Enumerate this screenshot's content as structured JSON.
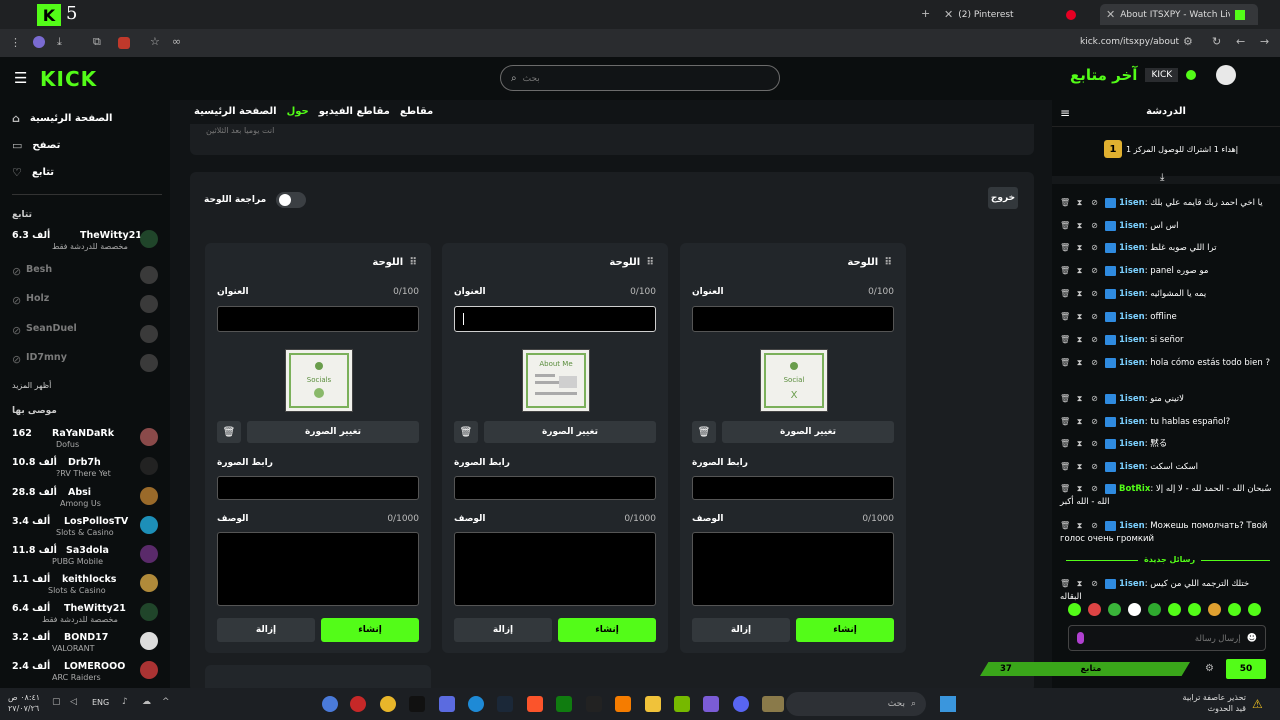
{
  "browser": {
    "tabs": [
      {
        "label": "(2) Pinterest"
      },
      {
        "label": "About ITSXPY - Watch Live on"
      }
    ],
    "url": "kick.com/itsxpy/about"
  },
  "header": {
    "logo": "KICK",
    "search_placeholder": "بحث",
    "overlay_text": "آخر متابع",
    "overlay_badge": "KICK"
  },
  "sidebar": {
    "nav": [
      {
        "label": "الصفحة الرئيسية"
      },
      {
        "label": "تصفح"
      },
      {
        "label": "تتابع"
      }
    ],
    "following_title": "تتابع",
    "following": [
      {
        "viewers": "6.3 ألف",
        "name": "TheWitty21",
        "sub": "مخصصة للدردشة فقط"
      }
    ],
    "offline": [
      "Besh",
      "Holz",
      "SeanDuel",
      "ID7mny"
    ],
    "show_more": "أظهر المزيد",
    "recommended_title": "موصى بها",
    "recommended": [
      {
        "viewers": "162",
        "name": "RaYaNDaRk",
        "sub": "Dofus"
      },
      {
        "viewers": "10.8 ألف",
        "name": "Drb7h",
        "sub": "?RV There Yet"
      },
      {
        "viewers": "28.8 ألف",
        "name": "Absi",
        "sub": "Among Us"
      },
      {
        "viewers": "3.4 ألف",
        "name": "LosPollosTV",
        "sub": "Slots & Casino"
      },
      {
        "viewers": "11.8 ألف",
        "name": "Sa3dola",
        "sub": "PUBG Mobile"
      },
      {
        "viewers": "1.1 ألف",
        "name": "keithlocks",
        "sub": "Slots & Casino"
      },
      {
        "viewers": "6.4 ألف",
        "name": "TheWitty21",
        "sub": "مخصصة للدردشة فقط"
      },
      {
        "viewers": "3.2 ألف",
        "name": "BOND17",
        "sub": "VALORANT"
      },
      {
        "viewers": "2.4 ألف",
        "name": "LOMEROOO",
        "sub": "ARC Raiders"
      }
    ]
  },
  "channel_tabs": [
    "مقاطع",
    "مقاطع الفيديو",
    "حول",
    "الصفحة الرئيسية"
  ],
  "topcard_text": "انت يوميا بعد الثلاثين",
  "editor": {
    "exit": "خروج",
    "review_label": "مراجعة اللوحة",
    "panels": [
      {
        "title": "اللوحة",
        "title_label": "العنوان",
        "title_count": "0/100",
        "change_image": "تغيير الصورة",
        "link_label": "رابط الصورة",
        "desc_label": "الوصف",
        "desc_count": "0/1000",
        "remove": "إزالة",
        "create": "إنشاء",
        "thumb_text": "Socials"
      },
      {
        "title": "اللوحة",
        "title_label": "العنوان",
        "title_count": "0/100",
        "change_image": "تغيير الصورة",
        "link_label": "رابط الصورة",
        "desc_label": "الوصف",
        "desc_count": "0/1000",
        "remove": "إزالة",
        "create": "إنشاء",
        "thumb_text": "About Me"
      },
      {
        "title": "اللوحة",
        "title_label": "العنوان",
        "title_count": "0/100",
        "change_image": "تغيير الصورة",
        "link_label": "رابط الصورة",
        "desc_label": "الوصف",
        "desc_count": "0/1000",
        "remove": "إزالة",
        "create": "إنشاء",
        "thumb_text": "Social"
      }
    ]
  },
  "chat": {
    "title": "الدردشة",
    "gift_text": "إهداء 1 اشتراك للوصول المركز 1",
    "gift_rank": "1",
    "messages": [
      {
        "user": "1isen",
        "text": "يا اخي احمد ربك قايمه علي بلك"
      },
      {
        "user": "1isen",
        "text": "اس اس"
      },
      {
        "user": "1isen",
        "text": "ترا اللي صوبه غلط"
      },
      {
        "user": "1isen",
        "text": "panel مو صوره"
      },
      {
        "user": "1isen",
        "text": "يمه يا المشوائيه"
      },
      {
        "user": "1isen",
        "text": "offline"
      },
      {
        "user": "1isen",
        "text": "si señor"
      },
      {
        "user": "1isen",
        "text": "hola cómo estás todo bien ?"
      },
      {
        "user": "1isen",
        "text": "لاتيني متو"
      },
      {
        "user": "1isen",
        "text": "tu hablas español?"
      },
      {
        "user": "1isen",
        "text": "黙る"
      },
      {
        "user": "1isen",
        "text": "اسكت اسكت"
      },
      {
        "user": "BotRix",
        "text": "سُبحان الله - الحمد لله - لا إله إلا الله - الله أكبر"
      },
      {
        "user": "1isen",
        "text": "Можешь помолчать? Твой голос очень громкий"
      }
    ],
    "new_messages": "رسائل جديدة",
    "last_message": {
      "user": "1isen",
      "text": "ختلك الترجمه اللي من كيس البقاله"
    },
    "send_placeholder": "إرسال رسالة",
    "goal_current": "37",
    "goal_label": "متابع",
    "goal_target": "50"
  },
  "taskbar": {
    "weather": "تحذير عاصفة ترابية",
    "weather_sub": "قيد الحدوث",
    "search": "بحث",
    "lang": "ENG",
    "time": "٠٨:٤١ ص",
    "date": "٢٧/٠٧/٢٦"
  }
}
